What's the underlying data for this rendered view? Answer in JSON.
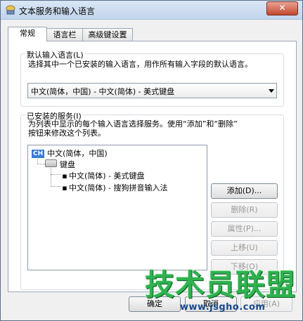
{
  "window": {
    "title": "文本服务和输入语言",
    "close_label": "✕"
  },
  "tabs": [
    {
      "label": "常规",
      "active": true
    },
    {
      "label": "语言栏",
      "active": false
    },
    {
      "label": "高级键设置",
      "active": false
    }
  ],
  "default_language": {
    "group_label": "默认输入语言(L)",
    "description": "选择其中一个已安装的输入语言，用作所有输入字段的默认语言。",
    "selected": "中文(简体，中国) - 中文(简体) - 美式键盘"
  },
  "installed_services": {
    "group_label": "已安装的服务(I)",
    "description_line1": "为列表中显示的每个输入语言选择服务。使用“添加”和“删除”",
    "description_line2": "按钮来修改这个列表。",
    "tree": {
      "language_badge": "CH",
      "language": "中文(简体，中国)",
      "category": "键盘",
      "items": [
        "中文(简体) - 美式键盘",
        "中文(简体) - 搜狗拼音输入法"
      ]
    },
    "buttons": {
      "add": "添加(D)...",
      "remove": "删除(R)",
      "properties": "属性(P)...",
      "move_up": "上移(U)",
      "move_down": "下移(O)"
    }
  },
  "footer": {
    "ok": "确定",
    "cancel": "取消",
    "apply": "应用(A)"
  },
  "watermark": {
    "text": "技术员联盟",
    "url": "www.jsgho.com"
  },
  "colors": {
    "close_button": "#c4482e",
    "badge": "#3a7bd5",
    "watermark": "#2eb24f"
  }
}
